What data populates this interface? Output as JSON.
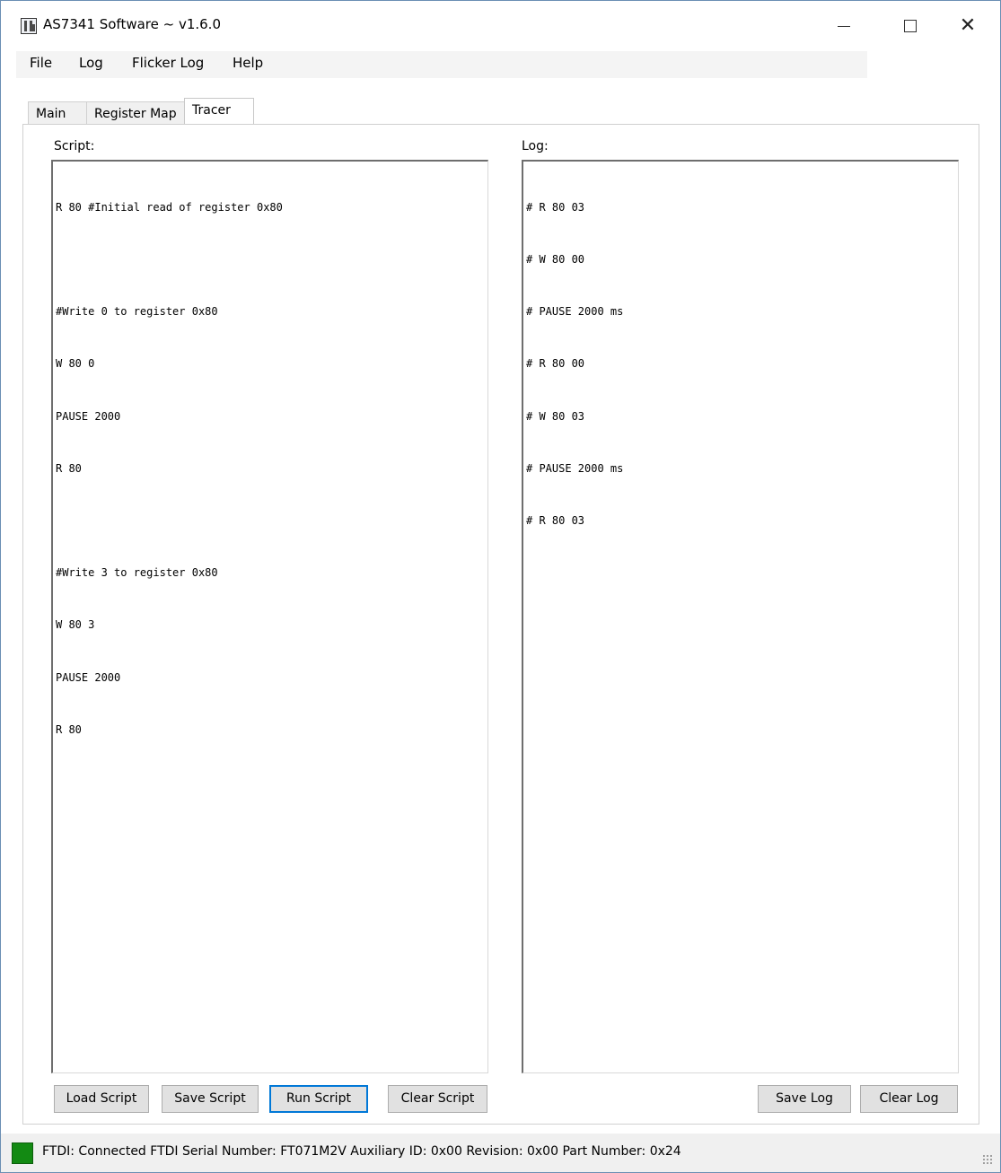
{
  "window": {
    "title": "AS7341 Software ~ v1.6.0",
    "controls": {
      "minimize": "—",
      "maximize": "☐",
      "close": "✕"
    }
  },
  "menu": {
    "items": [
      "File",
      "Log",
      "Flicker Log",
      "Help"
    ]
  },
  "tabs": [
    {
      "label": "Main",
      "active": false
    },
    {
      "label": "Register Map",
      "active": false
    },
    {
      "label": "Tracer",
      "active": true
    }
  ],
  "script": {
    "label": "Script:",
    "lines": [
      "R 80 #Initial read of register 0x80",
      "",
      "#Write 0 to register 0x80",
      "W 80 0",
      "PAUSE 2000",
      "R 80",
      "",
      "#Write 3 to register 0x80",
      "W 80 3",
      "PAUSE 2000",
      "R 80"
    ]
  },
  "log": {
    "label": "Log:",
    "lines": [
      "# R 80 03",
      "# W 80 00",
      "# PAUSE 2000 ms",
      "# R 80 00",
      "# W 80 03",
      "# PAUSE 2000 ms",
      "# R 80 03"
    ]
  },
  "buttons": {
    "load_script": "Load Script",
    "save_script": "Save Script",
    "run_script": "Run Script",
    "clear_script": "Clear Script",
    "save_log": "Save Log",
    "clear_log": "Clear Log"
  },
  "status": {
    "connection_color": "#138a13",
    "text": "FTDI: Connected  FTDI Serial Number: FT071M2V  Auxiliary ID: 0x00  Revision: 0x00  Part Number: 0x24"
  }
}
